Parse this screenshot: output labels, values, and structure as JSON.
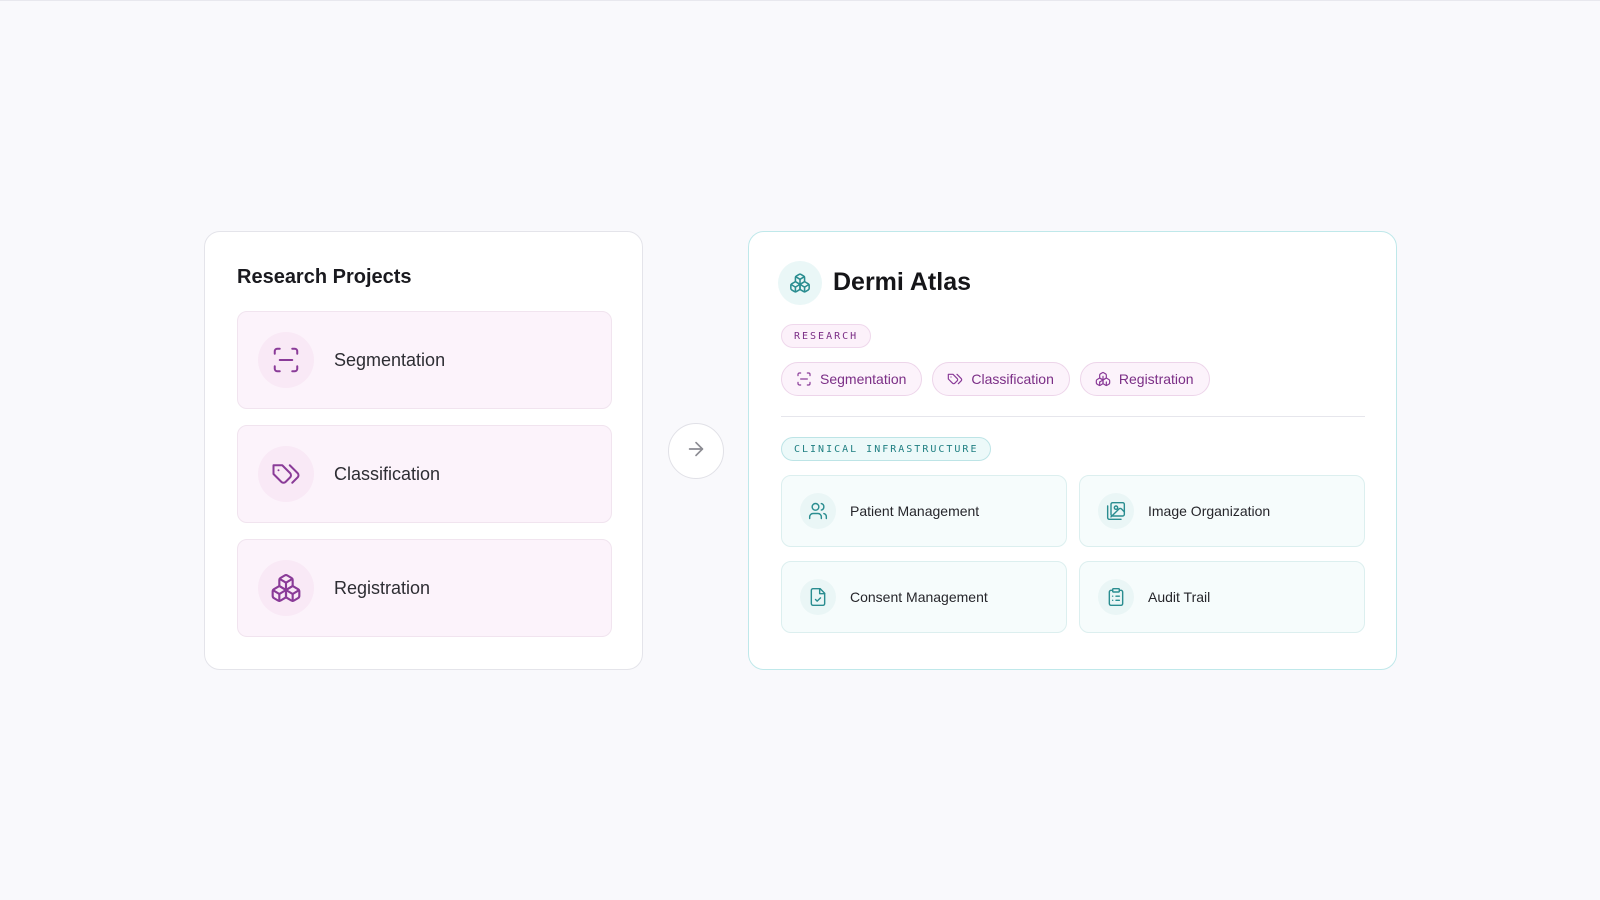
{
  "colors": {
    "background": "#f9f9fc",
    "research_accent": "#8a3b98",
    "clinical_accent": "#2a8d90",
    "arrow": "#8b8b92"
  },
  "research_projects": {
    "title": "Research Projects",
    "items": [
      {
        "label": "Segmentation",
        "icon": "scan-icon"
      },
      {
        "label": "Classification",
        "icon": "tag-icon"
      },
      {
        "label": "Registration",
        "icon": "boxes-icon"
      }
    ]
  },
  "arrow": {
    "icon": "arrow-right-icon"
  },
  "atlas": {
    "title": "Dermi Atlas",
    "icon": "boxes-icon",
    "research_tag": "RESEARCH",
    "research_chips": [
      {
        "label": "Segmentation",
        "icon": "scan-icon"
      },
      {
        "label": "Classification",
        "icon": "tag-icon"
      },
      {
        "label": "Registration",
        "icon": "boxes-icon"
      }
    ],
    "clinical_tag": "CLINICAL INFRASTRUCTURE",
    "clinical_items": [
      {
        "label": "Patient Management",
        "icon": "users-icon"
      },
      {
        "label": "Image Organization",
        "icon": "images-icon"
      },
      {
        "label": "Consent Management",
        "icon": "file-check-icon"
      },
      {
        "label": "Audit Trail",
        "icon": "clipboard-list-icon"
      }
    ]
  }
}
